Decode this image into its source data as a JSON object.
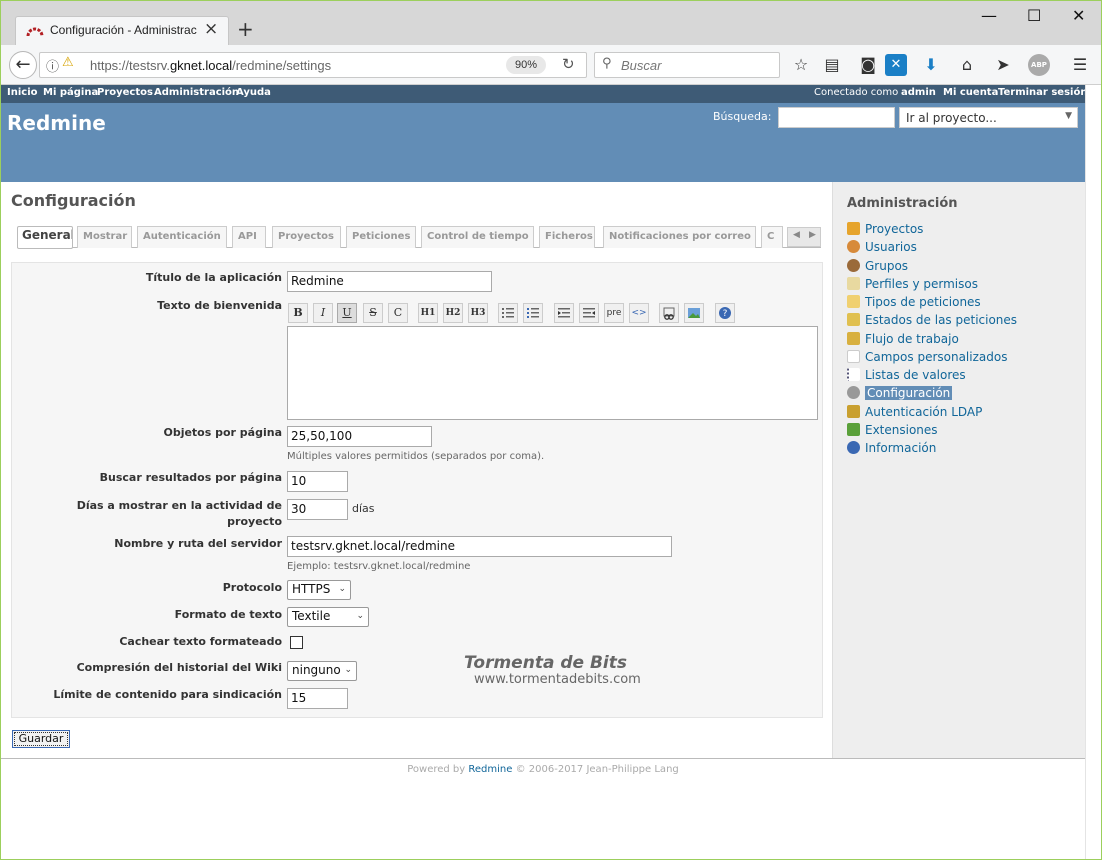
{
  "browser": {
    "tab_title": "Configuración - Administrac",
    "url_prefix": "https://testsrv.",
    "url_domain": "gknet.local",
    "url_path": "/redmine/settings",
    "zoom": "90%",
    "search_placeholder": "Buscar"
  },
  "top_menu": {
    "left": [
      "Inicio",
      "Mi página",
      "Proyectos",
      "Administración",
      "Ayuda"
    ],
    "logged_as": "Conectado como",
    "user": "admin",
    "my_account": "Mi cuenta",
    "logout": "Terminar sesión"
  },
  "header": {
    "title": "Redmine",
    "search_label": "Búsqueda:",
    "project_jump": "Ir al proyecto..."
  },
  "page": {
    "title": "Configuración",
    "tabs": [
      "General",
      "Mostrar",
      "Autenticación",
      "API",
      "Proyectos",
      "Peticiones",
      "Control de tiempo",
      "Ficheros",
      "Notificaciones por correo",
      "C"
    ],
    "fields": {
      "app_title_label": "Título de la aplicación",
      "app_title_value": "Redmine",
      "welcome_label": "Texto de bienvenida",
      "per_page_label": "Objetos por página",
      "per_page_value": "25,50,100",
      "per_page_hint": "Múltiples valores permitidos (separados por coma).",
      "search_results_label": "Buscar resultados por página",
      "search_results_value": "10",
      "activity_days_label_1": "Días a mostrar en la actividad de",
      "activity_days_label_2": "proyecto",
      "activity_days_value": "30",
      "activity_days_unit": "días",
      "host_label": "Nombre y ruta del servidor",
      "host_value": "testsrv.gknet.local/redmine",
      "host_hint": "Ejemplo: testsrv.gknet.local/redmine",
      "protocol_label": "Protocolo",
      "protocol_value": "HTTPS",
      "text_format_label": "Formato de texto",
      "text_format_value": "Textile",
      "cache_label": "Cachear texto formateado",
      "wiki_compress_label": "Compresión del historial del Wiki",
      "wiki_compress_value": "ninguno",
      "feed_limit_label": "Límite de contenido para sindicación",
      "feed_limit_value": "15"
    },
    "toolbar": [
      "B",
      "I",
      "U",
      "S",
      "C",
      "H1",
      "H2",
      "H3",
      "ul",
      "ol",
      "<",
      ">",
      "pre",
      "<>",
      "link",
      "img",
      "?"
    ],
    "save": "Guardar",
    "watermark_title": "Tormenta de Bits",
    "watermark_url": "www.tormentadebits.com"
  },
  "sidebar": {
    "heading": "Administración",
    "items": [
      "Proyectos",
      "Usuarios",
      "Grupos",
      "Perfiles y permisos",
      "Tipos de peticiones",
      "Estados de las peticiones",
      "Flujo de trabajo",
      "Campos personalizados",
      "Listas de valores",
      "Configuración",
      "Autenticación LDAP",
      "Extensiones",
      "Información"
    ]
  },
  "footer": {
    "prefix": "Powered by",
    "link": "Redmine",
    "suffix": "© 2006-2017 Jean-Philippe Lang"
  }
}
